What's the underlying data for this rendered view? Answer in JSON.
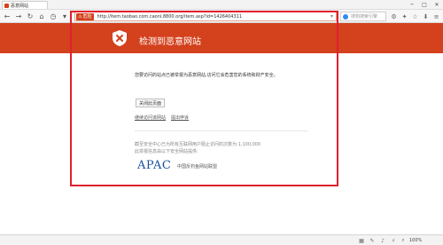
{
  "tab": {
    "title": "恶意网站"
  },
  "window": {
    "minimize": "─",
    "maximize": "□",
    "close": "✕"
  },
  "nav": {
    "back": "←",
    "forward": "→",
    "reload": "↻",
    "home": "⌂",
    "history": "◷",
    "down": "▾"
  },
  "address": {
    "badge_icon": "⚠",
    "badge_label": "危险",
    "url": "http://item.taobao.com.caoni.8800.org/item.asp?id=1426404311",
    "dropdown": "▾"
  },
  "search": {
    "placeholder": "搜狗搜索引擎"
  },
  "banner": {
    "title": "检测到恶意网站",
    "color": "#d4411d"
  },
  "content": {
    "warning": "您要访问的站点已被举报为恶意网站,访问它会危害您的系统和财产安全。",
    "close_button": "关闭此页面",
    "continue_link": "继续访问该网站",
    "report_link": "提出申诉",
    "stats_line1": "截至安全中心已为所有互联网用户阻止访问的次数为:1,100,000",
    "stats_line2": "此举报信息由以下安全网站提供:",
    "logo_text": "APAC",
    "alliance": "中国反钓鱼网站联盟"
  },
  "statusbar": {
    "zoom": "100%"
  },
  "annotation_color": "#e0202e"
}
